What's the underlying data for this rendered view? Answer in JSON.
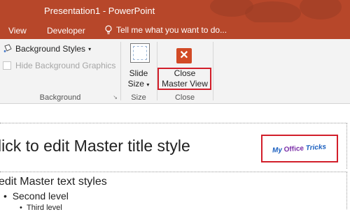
{
  "window": {
    "title": "Presentation1 - PowerPoint",
    "title_color": "#b7472a"
  },
  "menu": {
    "tabs": [
      "View",
      "Developer"
    ],
    "tell_me": "Tell me what you want to do..."
  },
  "ribbon": {
    "background_group": {
      "background_styles": "Background Styles",
      "hide_graphics": "Hide Background Graphics",
      "hide_graphics_checked": false,
      "label": "Background"
    },
    "size_group": {
      "slide_size_line1": "Slide",
      "slide_size_line2": "Size",
      "label": "Size"
    },
    "close_group": {
      "close_line1": "Close",
      "close_line2": "Master View",
      "label": "Close"
    }
  },
  "slide": {
    "title_placeholder": "lick to edit Master title style",
    "logo_text_1": "My",
    "logo_text_2": "Office",
    "logo_text_3": "Tricks",
    "body_level1": "edit Master text styles",
    "body_level2": "Second level",
    "body_level3": "Third level"
  },
  "colors": {
    "accent": "#b7472a",
    "highlight": "#d21e2a",
    "close_icon": "#d24a26"
  }
}
